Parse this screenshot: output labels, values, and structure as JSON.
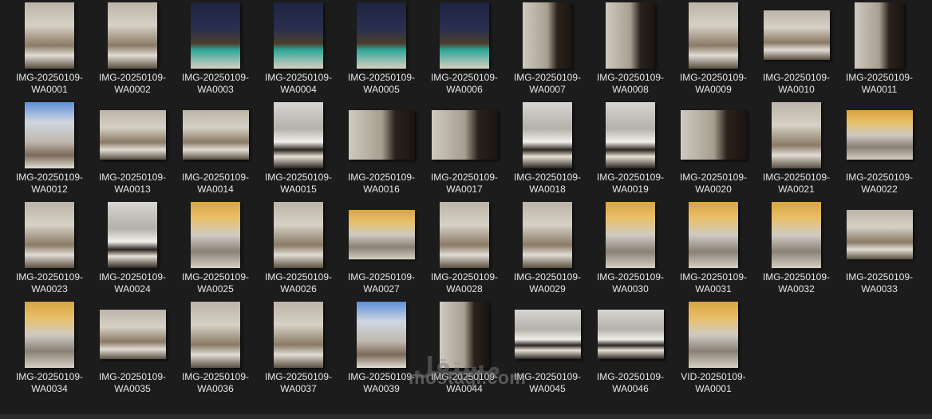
{
  "files": [
    {
      "name": "IMG-20250109-WA0001"
    },
    {
      "name": "IMG-20250109-WA0002"
    },
    {
      "name": "IMG-20250109-WA0003"
    },
    {
      "name": "IMG-20250109-WA0004"
    },
    {
      "name": "IMG-20250109-WA0005"
    },
    {
      "name": "IMG-20250109-WA0006"
    },
    {
      "name": "IMG-20250109-WA0007"
    },
    {
      "name": "IMG-20250109-WA0008"
    },
    {
      "name": "IMG-20250109-WA0009"
    },
    {
      "name": "IMG-20250109-WA0010"
    },
    {
      "name": "IMG-20250109-WA0011"
    },
    {
      "name": "IMG-20250109-WA0012"
    },
    {
      "name": "IMG-20250109-WA0013"
    },
    {
      "name": "IMG-20250109-WA0014"
    },
    {
      "name": "IMG-20250109-WA0015"
    },
    {
      "name": "IMG-20250109-WA0016"
    },
    {
      "name": "IMG-20250109-WA0017"
    },
    {
      "name": "IMG-20250109-WA0018"
    },
    {
      "name": "IMG-20250109-WA0019"
    },
    {
      "name": "IMG-20250109-WA0020"
    },
    {
      "name": "IMG-20250109-WA0021"
    },
    {
      "name": "IMG-20250109-WA0022"
    },
    {
      "name": "IMG-20250109-WA0023"
    },
    {
      "name": "IMG-20250109-WA0024"
    },
    {
      "name": "IMG-20250109-WA0025"
    },
    {
      "name": "IMG-20250109-WA0026"
    },
    {
      "name": "IMG-20250109-WA0027"
    },
    {
      "name": "IMG-20250109-WA0028"
    },
    {
      "name": "IMG-20250109-WA0029"
    },
    {
      "name": "IMG-20250109-WA0030"
    },
    {
      "name": "IMG-20250109-WA0031"
    },
    {
      "name": "IMG-20250109-WA0032"
    },
    {
      "name": "IMG-20250109-WA0033"
    },
    {
      "name": "IMG-20250109-WA0034"
    },
    {
      "name": "IMG-20250109-WA0035"
    },
    {
      "name": "IMG-20250109-WA0036"
    },
    {
      "name": "IMG-20250109-WA0037"
    },
    {
      "name": "IMG-20250109-WA0039"
    },
    {
      "name": "IMG-20250109-WA0044"
    },
    {
      "name": "IMG-20250109-WA0045"
    },
    {
      "name": "IMG-20250109-WA0046"
    },
    {
      "name": "VID-20250109-WA0001"
    }
  ],
  "watermark": {
    "text": "mostaql.com",
    "logo": "مستقل"
  }
}
